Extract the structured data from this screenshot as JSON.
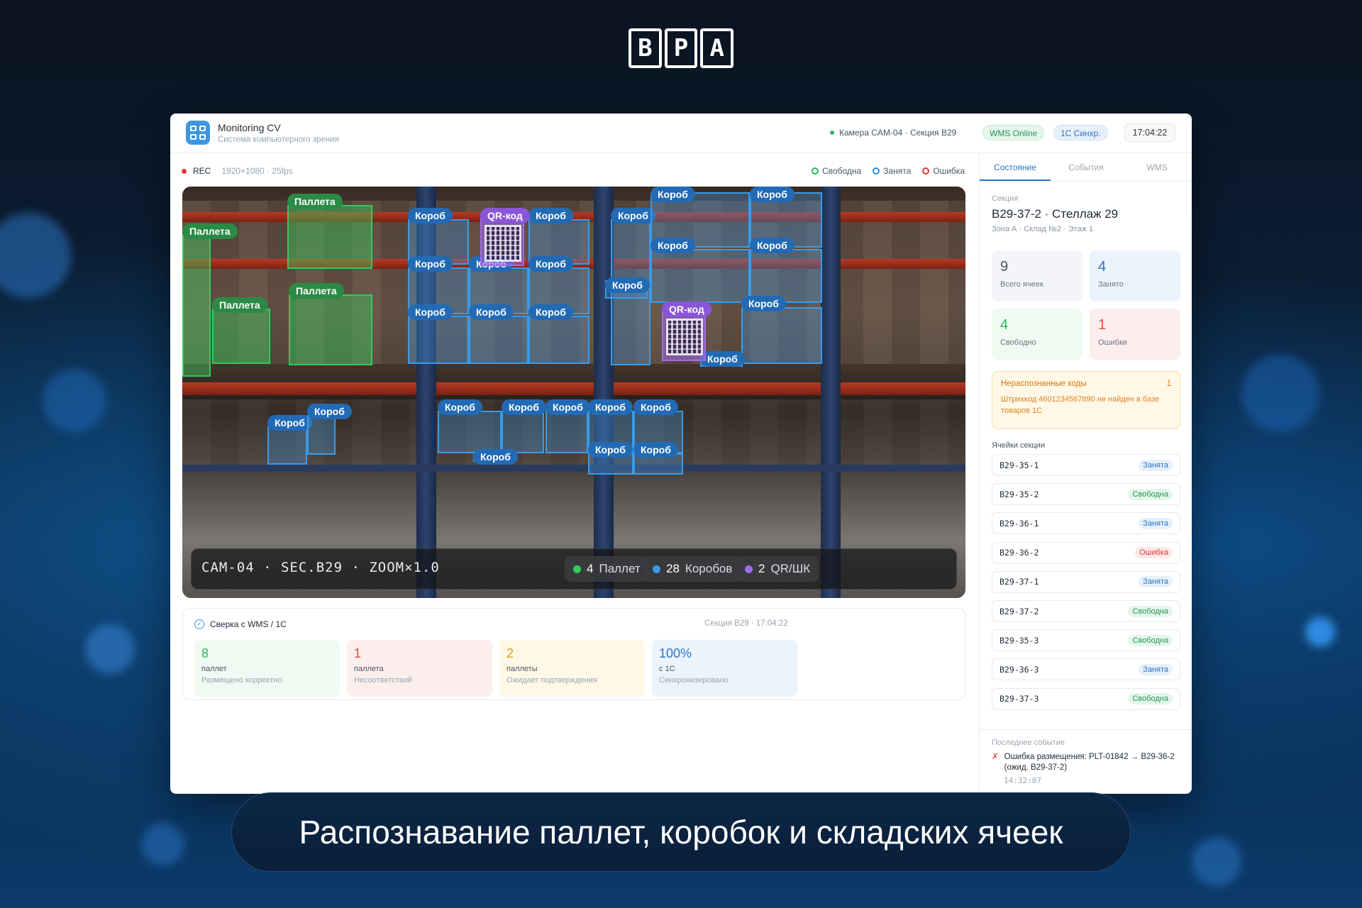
{
  "brand": {
    "logo_letters": [
      "В",
      "Р",
      "А"
    ]
  },
  "app": {
    "title": "Monitoring CV",
    "subtitle": "Система компьютерного зрения"
  },
  "header": {
    "camera_status": "Камера CAM-04 · Секция B29",
    "wms_pill": "WMS Online",
    "sync_pill": "1С Синхр.",
    "time": "17:04:22"
  },
  "camera": {
    "rec_label": "REC",
    "resolution": "1920×1080 · 25fps",
    "legend": [
      {
        "label": "Свободна",
        "color": "#2fb85a"
      },
      {
        "label": "Занята",
        "color": "#2c8fe0"
      },
      {
        "label": "Ошибка",
        "color": "#e23b3b"
      }
    ],
    "overlay_text": "CAM-04 · SEC.B29 · ZOOM×1.0",
    "counts": [
      {
        "value": "4",
        "label": "Паллет",
        "color": "#2fcc5e"
      },
      {
        "value": "28",
        "label": "Коробов",
        "color": "#3a9be8"
      },
      {
        "value": "2",
        "label": "QR/ШК",
        "color": "#a06be8"
      }
    ],
    "label_box": "Короб",
    "label_pallet": "Паллета",
    "label_qr": "QR-код"
  },
  "reconciliation": {
    "title": "Сверка с WMS / 1С",
    "meta": "Секция B29 · 17:04:22",
    "cards": [
      {
        "num": "8",
        "unit": "паллет",
        "desc": "Размещено корректно",
        "color": "#2fb85a",
        "bg": "#eefaf2"
      },
      {
        "num": "1",
        "unit": "паллета",
        "desc": "Несоответствий",
        "color": "#e0503a",
        "bg": "#fdeeee"
      },
      {
        "num": "2",
        "unit": "паллеты",
        "desc": "Ожидает подтверждения",
        "color": "#e09a1a",
        "bg": "#fff8e6"
      },
      {
        "num": "100%",
        "unit": "с 1С",
        "desc": "Синхронизировано",
        "color": "#2c74c4",
        "bg": "#ebf3fc"
      }
    ]
  },
  "panel": {
    "tabs": [
      "Состояние",
      "События",
      "WMS"
    ],
    "section_label": "Секция",
    "section_title": "B29-37-2 · Стеллаж 29",
    "section_sub": "Зона А · Склад №2 · Этаж 1",
    "stats": [
      {
        "num": "9",
        "label": "Всего ячеек",
        "color": "#4a5563",
        "bg": "#f3f5f8"
      },
      {
        "num": "4",
        "label": "Занято",
        "color": "#2c74c4",
        "bg": "#ebf3fc"
      },
      {
        "num": "4",
        "label": "Свободно",
        "color": "#2fb85a",
        "bg": "#eefaf2"
      },
      {
        "num": "1",
        "label": "Ошибки",
        "color": "#e0503a",
        "bg": "#fdeeee"
      }
    ],
    "alert": {
      "title": "Нераспознанные коды",
      "count": "1",
      "body": "Штрихкод 4601234567890 не найден в базе товаров 1С"
    },
    "cells_label": "Ячейки секции",
    "cells": [
      {
        "id": "B29-35-1",
        "status": "Занята",
        "kind": "occ"
      },
      {
        "id": "B29-35-2",
        "status": "Свободна",
        "kind": "free"
      },
      {
        "id": "B29-36-1",
        "status": "Занята",
        "kind": "occ"
      },
      {
        "id": "B29-36-2",
        "status": "Ошибка",
        "kind": "err"
      },
      {
        "id": "B29-37-1",
        "status": "Занята",
        "kind": "occ"
      },
      {
        "id": "B29-37-2",
        "status": "Свободна",
        "kind": "free"
      },
      {
        "id": "B29-35-3",
        "status": "Свободна",
        "kind": "free"
      },
      {
        "id": "B29-36-3",
        "status": "Занята",
        "kind": "occ"
      },
      {
        "id": "B29-37-3",
        "status": "Свободна",
        "kind": "free"
      }
    ],
    "last_event_label": "Последнее событие",
    "last_event_text": "Ошибка размещения: PLT-01842 → B29-36-2 (ожид. B29-37-2)",
    "last_event_time": "14:32:07",
    "last_event_icon": "✗"
  },
  "caption": "Распознавание паллет, коробок и складских ячеек"
}
